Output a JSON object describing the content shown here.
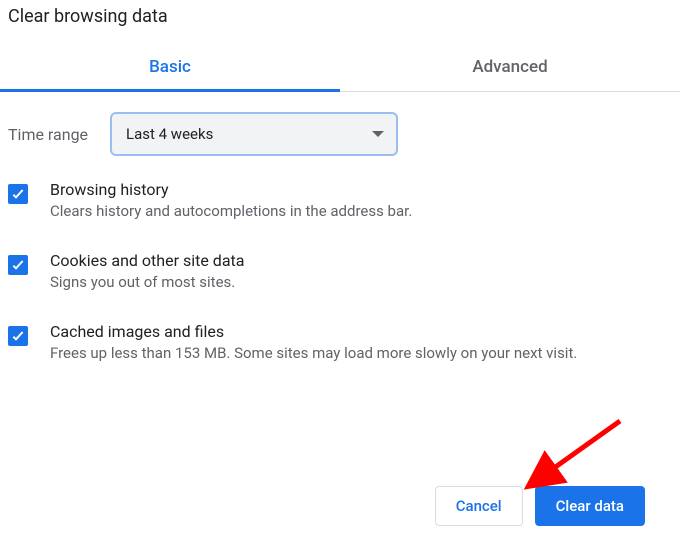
{
  "header": {
    "title": "Clear browsing data"
  },
  "tabs": {
    "basic": "Basic",
    "advanced": "Advanced",
    "activeIndex": 0
  },
  "timeRange": {
    "label": "Time range",
    "value": "Last 4 weeks"
  },
  "options": [
    {
      "title": "Browsing history",
      "desc": "Clears history and autocompletions in the address bar.",
      "checked": true
    },
    {
      "title": "Cookies and other site data",
      "desc": "Signs you out of most sites.",
      "checked": true
    },
    {
      "title": "Cached images and files",
      "desc": "Frees up less than 153 MB. Some sites may load more slowly on your next visit.",
      "checked": true
    }
  ],
  "buttons": {
    "cancel": "Cancel",
    "clear": "Clear data"
  },
  "annotation": {
    "arrowColor": "#ff0000"
  }
}
